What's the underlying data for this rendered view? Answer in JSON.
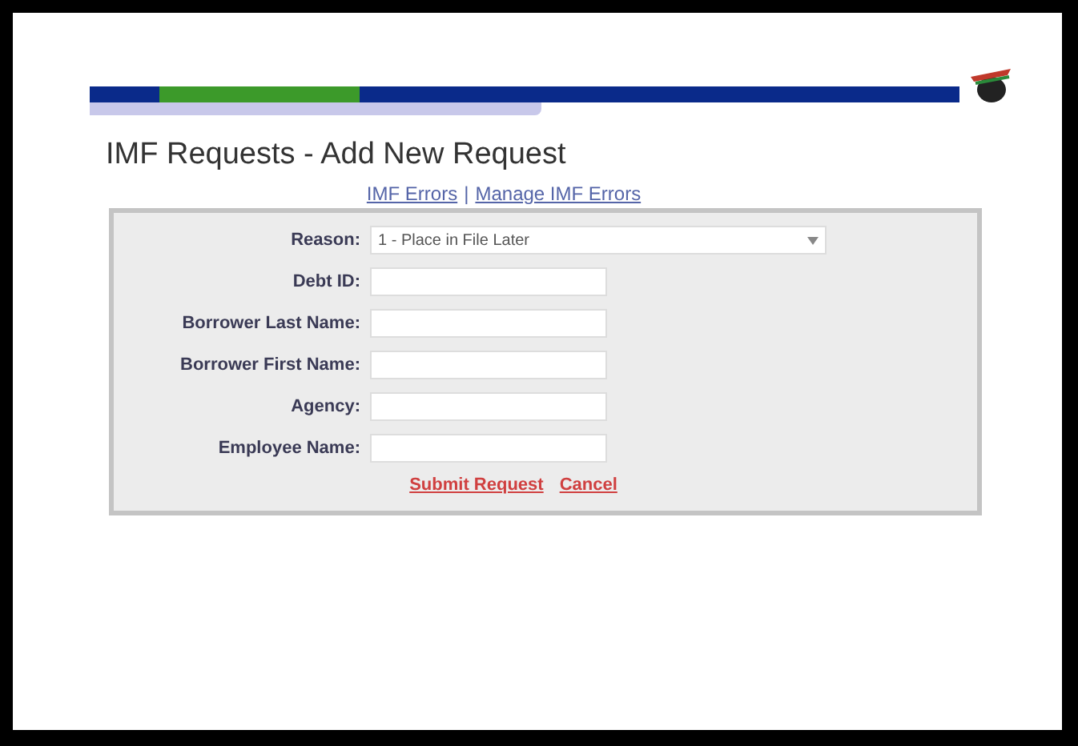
{
  "title": "IMF Requests - Add New Request",
  "links": [
    "IMF Errors",
    "Manage IMF Errors"
  ],
  "link_separator": "|",
  "form": {
    "reason": {
      "label": "Reason:",
      "value": "1 - Place in File Later"
    },
    "fields": [
      {
        "label": "Debt ID:"
      },
      {
        "label": "Borrower Last Name:"
      },
      {
        "label": "Borrower First Name:"
      },
      {
        "label": "Agency:"
      },
      {
        "label": "Employee Name:"
      }
    ]
  },
  "actions": [
    "Submit Request",
    "Cancel"
  ]
}
